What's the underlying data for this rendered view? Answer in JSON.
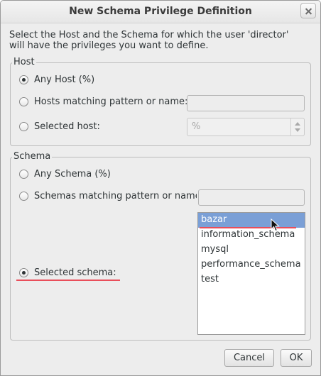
{
  "window": {
    "title": "New Schema Privilege Definition"
  },
  "intro": {
    "line1": "Select the Host and the Schema for which the user 'director'",
    "line2": "will have the privileges you want to define."
  },
  "host": {
    "legend": "Host",
    "options": [
      {
        "label": "Any Host (%)",
        "checked": true
      },
      {
        "label": "Hosts matching pattern or name:",
        "checked": false
      },
      {
        "label": "Selected host:",
        "checked": false
      }
    ],
    "pattern_value": "",
    "selected_host_value": "%"
  },
  "schema": {
    "legend": "Schema",
    "options": [
      {
        "label": "Any Schema (%)",
        "checked": false
      },
      {
        "label": "Schemas matching pattern or name:",
        "checked": false
      },
      {
        "label": "Selected schema:",
        "checked": true
      }
    ],
    "pattern_value": "",
    "list": [
      "bazar",
      "information_schema",
      "mysql",
      "performance_schema",
      "test"
    ],
    "selected_index": 0
  },
  "buttons": {
    "cancel": "Cancel",
    "ok": "OK"
  },
  "colors": {
    "selection": "#7a9fd6",
    "annotation_underline": "#e94e5a"
  }
}
